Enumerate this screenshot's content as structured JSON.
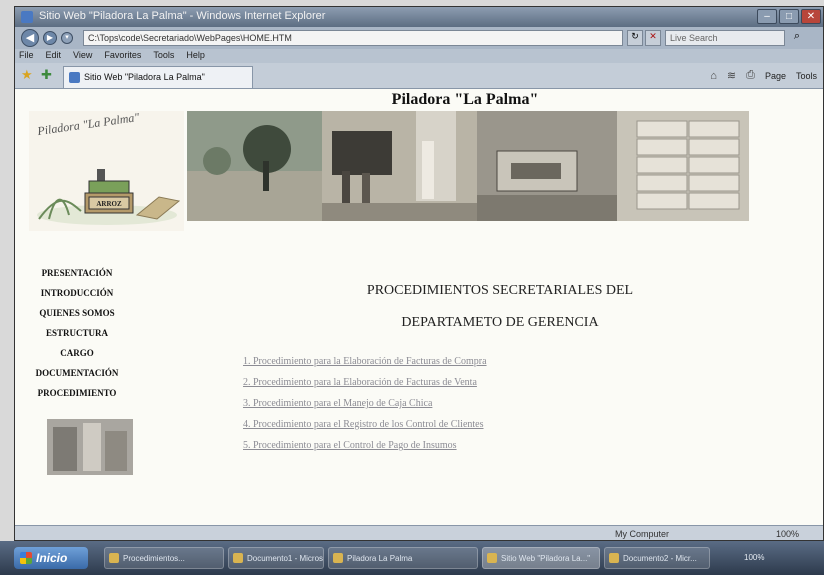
{
  "browser": {
    "window_title": "Sitio Web \"Piladora La Palma\" - Windows Internet Explorer",
    "url": "C:\\Tops\\code\\Secretariado\\WebPages\\HOME.HTM",
    "search_placeholder": "Live Search",
    "menu": [
      "File",
      "Edit",
      "View",
      "Favorites",
      "Tools",
      "Help"
    ],
    "tab_label": "Sitio Web \"Piladora La Palma\"",
    "commands": [
      "Page",
      "Tools"
    ],
    "status_zone": "My Computer",
    "zoom": "100%"
  },
  "page": {
    "title": "Piladora \"La Palma\"",
    "logo_text": "Piladora \"La Palma\"",
    "logo_sign": "ARROZ",
    "side_menu": [
      "PRESENTACIÓN",
      "INTRODUCCIÓN",
      "QUIENES SOMOS",
      "ESTRUCTURA",
      "CARGO",
      "DOCUMENTACIÓN",
      "PROCEDIMIENTO"
    ],
    "heading_line1": "PROCEDIMIENTOS SECRETARIALES DEL",
    "heading_line2": "DEPARTAMETO DE GERENCIA",
    "procedures": [
      "1. Procedimiento para la Elaboración de Facturas de Compra",
      "2. Procedimiento para la Elaboración de Facturas de Venta",
      "3. Procedimiento para el Manejo de Caja Chica",
      "4. Procedimiento para el Registro de los Control de Clientes",
      "5. Procedimiento para el Control de Pago de Insumos"
    ]
  },
  "taskbar": {
    "start_label": "Inicio",
    "tasks": [
      "Procedimientos...",
      "Documento1 - Microsoft...",
      "Piladora La Palma",
      "Sitio Web \"Piladora La...\"",
      "Documento2 - Micr..."
    ],
    "tray_label": "100%"
  },
  "colors": {
    "link": "#8c8c94",
    "page_background": "#fbfbf6",
    "frame": "#6e7b8c"
  }
}
